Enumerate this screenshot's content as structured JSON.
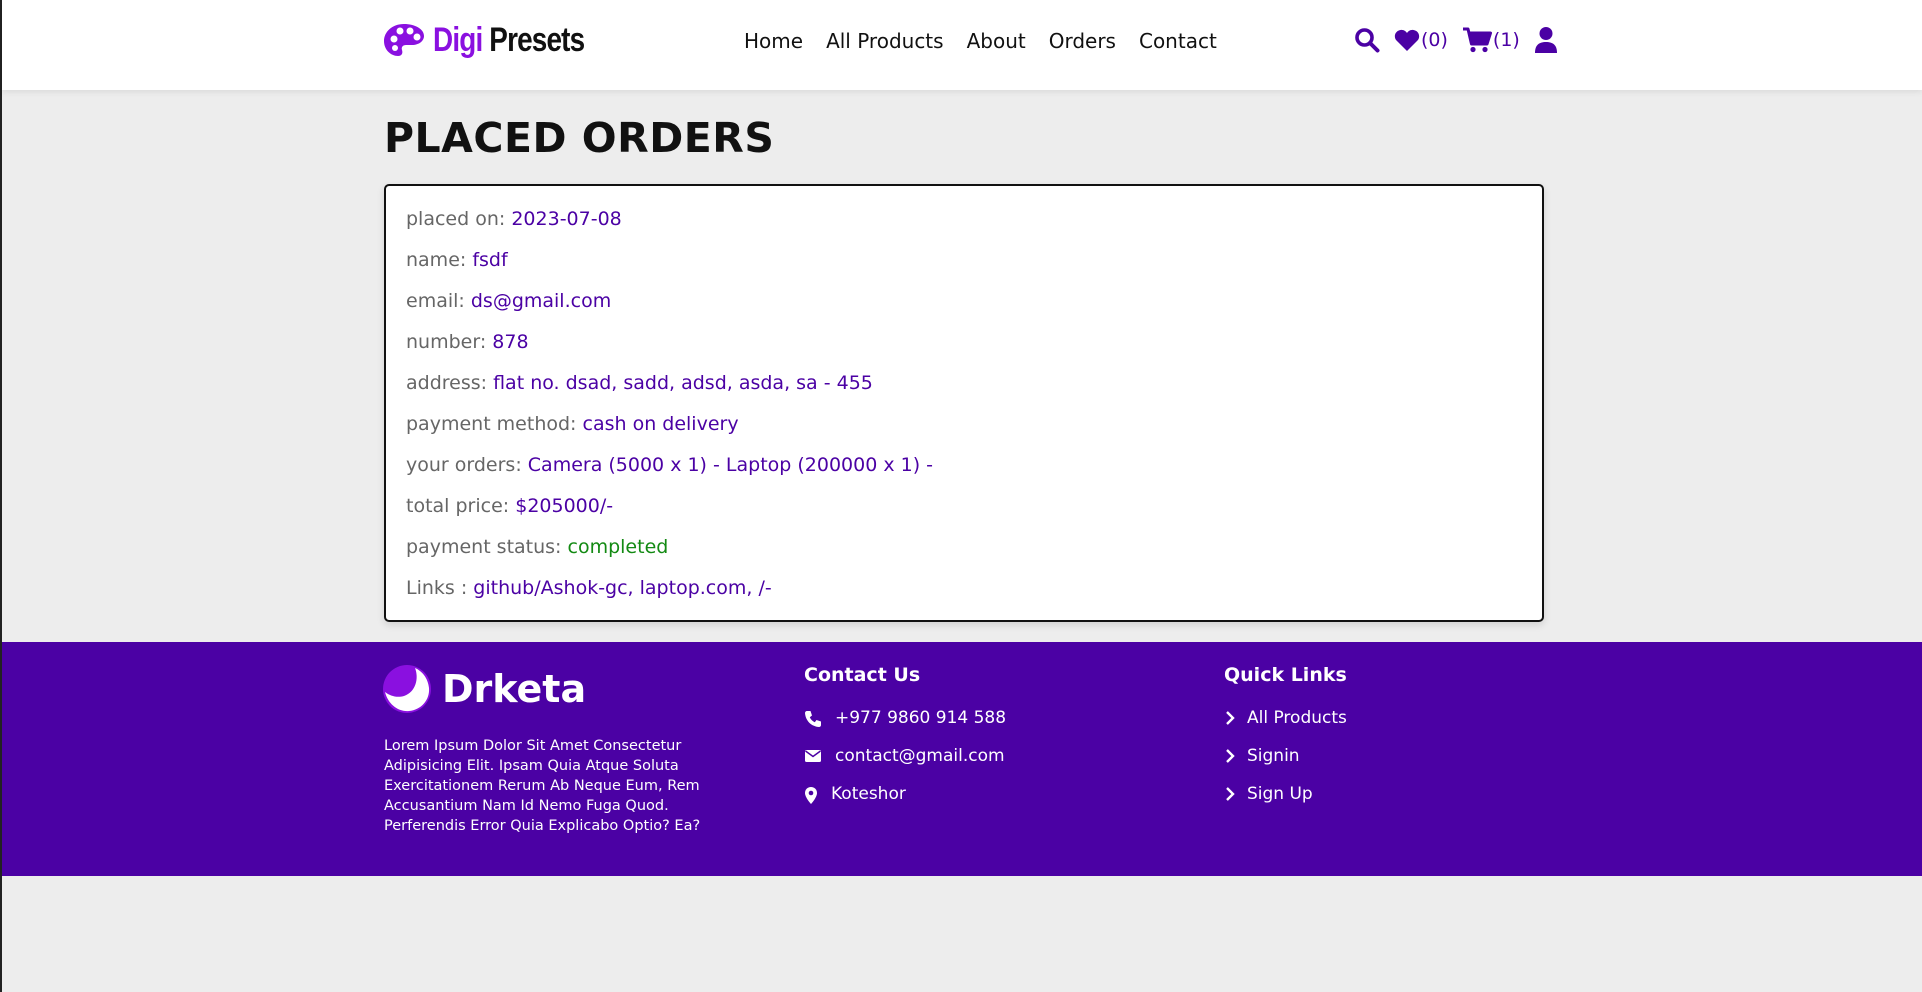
{
  "header": {
    "brand": {
      "part1": "Digi",
      "part2": "Presets",
      "color": "#8a10e0"
    },
    "nav": [
      "Home",
      "All Products",
      "About",
      "Orders",
      "Contact"
    ],
    "wishlist_count": "(0)",
    "cart_count": "(1)",
    "icons": [
      "search-icon",
      "heart-icon",
      "cart-icon",
      "user-icon"
    ]
  },
  "main": {
    "title": "PLACED ORDERS",
    "order": {
      "placed_on": {
        "label": "placed on:",
        "value": "2023-07-08"
      },
      "name": {
        "label": "name:",
        "value": "fsdf"
      },
      "email": {
        "label": "email:",
        "value": "ds@gmail.com"
      },
      "number": {
        "label": "number:",
        "value": "878"
      },
      "address": {
        "label": "address:",
        "value": "flat no. dsad, sadd, adsd, asda, sa - 455"
      },
      "payment_method": {
        "label": "payment method:",
        "value": "cash on delivery"
      },
      "your_orders": {
        "label": "your orders:",
        "value": "Camera (5000 x 1) - Laptop (200000 x 1) -"
      },
      "total_price": {
        "label": "total price:",
        "value": "$205000/-"
      },
      "payment_status": {
        "label": "payment status:",
        "value": "completed",
        "color": "#138a13"
      },
      "links": {
        "label": "Links :",
        "value": "github/Ashok-gc, laptop.com, /-"
      }
    }
  },
  "footer": {
    "brand": "Drketa",
    "description": "Lorem Ipsum Dolor Sit Amet Consectetur Adipisicing Elit. Ipsam Quia Atque Soluta Exercitationem Rerum Ab Neque Eum, Rem Accusantium Nam Id Nemo Fuga Quod. Perferendis Error Quia Explicabo Optio? Ea?",
    "contact": {
      "title": "Contact Us",
      "phone": "+977 9860 914 588",
      "email": "contact@gmail.com",
      "location": "Koteshor"
    },
    "quick_links": {
      "title": "Quick Links",
      "items": [
        "All Products",
        "Signin",
        "Sign Up"
      ]
    },
    "color": "#4b01a4"
  }
}
